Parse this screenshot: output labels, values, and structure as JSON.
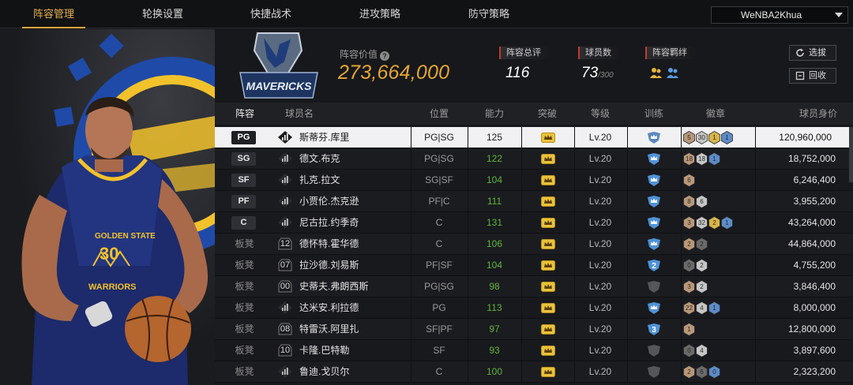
{
  "tabs": [
    {
      "label": "阵容管理",
      "active": true
    },
    {
      "label": "轮换设置",
      "active": false
    },
    {
      "label": "快捷战术",
      "active": false
    },
    {
      "label": "进攻策略",
      "active": false
    },
    {
      "label": "防守策略",
      "active": false
    }
  ],
  "team_select": {
    "value": "WeNBA2Khua"
  },
  "hero": {
    "jersey_text_team": "GOLDEN STATE",
    "jersey_number": "30",
    "jersey_text_name": "WARRIORS"
  },
  "logo": {
    "text": "MAVERICKS"
  },
  "lineup_value": {
    "label": "阵容价值",
    "amount": "273,664,000"
  },
  "stats": {
    "overall": {
      "label": "阵容总评",
      "value": "116"
    },
    "players": {
      "label": "球员数",
      "value": "73",
      "max": "/300"
    },
    "bond": {
      "label": "阵容羁绊"
    }
  },
  "buttons": {
    "pick": "选拔",
    "recycle": "回收"
  },
  "columns": [
    "阵容",
    "球员名",
    "位置",
    "能力",
    "突破",
    "等级",
    "训练",
    "徽章",
    "球员身价"
  ],
  "colors": {
    "accent": "#e2a23a",
    "ovr_green": "#5fb53b",
    "stat_red": "#c23a2d"
  },
  "rows": [
    {
      "slot": "PG",
      "bench": false,
      "num": "",
      "name": "斯蒂芬.库里",
      "pos": "PG|SG",
      "ovr": "125",
      "lv": "Lv.20",
      "train": "gold",
      "badges": [
        [
          "5",
          "bronze"
        ],
        [
          "30",
          "silver"
        ],
        [
          "1",
          "gold"
        ],
        [
          "1",
          "blue"
        ]
      ],
      "value": "120,960,000"
    },
    {
      "slot": "SG",
      "bench": false,
      "num": "",
      "name": "德文.布克",
      "pos": "PG|SG",
      "ovr": "122",
      "lv": "Lv.20",
      "train": "blue",
      "badges": [
        [
          "18",
          "bronze"
        ],
        [
          "18",
          "silver"
        ],
        [
          "1",
          "blue"
        ]
      ],
      "value": "18,752,000"
    },
    {
      "slot": "SF",
      "bench": false,
      "num": "",
      "name": "扎克.拉文",
      "pos": "SG|SF",
      "ovr": "104",
      "lv": "Lv.20",
      "train": "blue",
      "badges": [
        [
          "6",
          "bronze"
        ]
      ],
      "value": "6,246,400"
    },
    {
      "slot": "PF",
      "bench": false,
      "num": "",
      "name": "小贾伦.杰克逊",
      "pos": "PF|C",
      "ovr": "111",
      "lv": "Lv.20",
      "train": "blue",
      "badges": [
        [
          "8",
          "bronze"
        ],
        [
          "6",
          "silver"
        ]
      ],
      "value": "3,955,200"
    },
    {
      "slot": "C",
      "bench": false,
      "num": "",
      "name": "尼古拉.约季奇",
      "pos": "C",
      "ovr": "131",
      "lv": "Lv.20",
      "train": "blue",
      "badges": [
        [
          "3",
          "bronze"
        ],
        [
          "32",
          "silver"
        ],
        [
          "2",
          "gold"
        ],
        [
          "1",
          "blue"
        ]
      ],
      "value": "43,264,000"
    },
    {
      "slot": "板凳",
      "bench": true,
      "num": "12",
      "name": "德怀特.霍华德",
      "pos": "C",
      "ovr": "106",
      "lv": "Lv.20",
      "train": "blue",
      "badges": [
        [
          "2",
          "bronze"
        ],
        [
          "2",
          "dark"
        ]
      ],
      "value": "44,864,000"
    },
    {
      "slot": "板凳",
      "bench": true,
      "num": "07",
      "name": "拉沙德.刘易斯",
      "pos": "PF|SF",
      "ovr": "104",
      "lv": "Lv.20",
      "train": "2",
      "badges": [
        [
          "0",
          "dark"
        ],
        [
          "2",
          "silver"
        ]
      ],
      "value": "4,755,200"
    },
    {
      "slot": "板凳",
      "bench": true,
      "num": "00",
      "name": "史蒂夫.弗朗西斯",
      "pos": "PG|SG",
      "ovr": "98",
      "lv": "Lv.20",
      "train": "gray",
      "badges": [
        [
          "3",
          "bronze"
        ],
        [
          "2",
          "silver"
        ]
      ],
      "value": "3,846,400"
    },
    {
      "slot": "板凳",
      "bench": true,
      "num": "",
      "name": "达米安.利拉德",
      "pos": "PG",
      "ovr": "113",
      "lv": "Lv.20",
      "train": "blue",
      "badges": [
        [
          "22",
          "bronze"
        ],
        [
          "4",
          "silver"
        ],
        [
          "1",
          "blue"
        ]
      ],
      "value": "8,000,000"
    },
    {
      "slot": "板凳",
      "bench": true,
      "num": "08",
      "name": "特雷沃.阿里扎",
      "pos": "SF|PF",
      "ovr": "97",
      "lv": "Lv.20",
      "train": "3",
      "badges": [
        [
          "1",
          "bronze"
        ]
      ],
      "value": "12,800,000"
    },
    {
      "slot": "板凳",
      "bench": true,
      "num": "10",
      "name": "卡隆.巴特勒",
      "pos": "SF",
      "ovr": "93",
      "lv": "Lv.20",
      "train": "gray",
      "badges": [
        [
          "0",
          "dark"
        ],
        [
          "4",
          "silver"
        ]
      ],
      "value": "3,897,600"
    },
    {
      "slot": "板凳",
      "bench": true,
      "num": "",
      "name": "鲁迪.戈贝尔",
      "pos": "C",
      "ovr": "100",
      "lv": "Lv.20",
      "train": "gray",
      "badges": [
        [
          "2",
          "bronze"
        ],
        [
          "6",
          "dark"
        ],
        [
          "0",
          "blue"
        ]
      ],
      "value": "2,323,200"
    }
  ]
}
